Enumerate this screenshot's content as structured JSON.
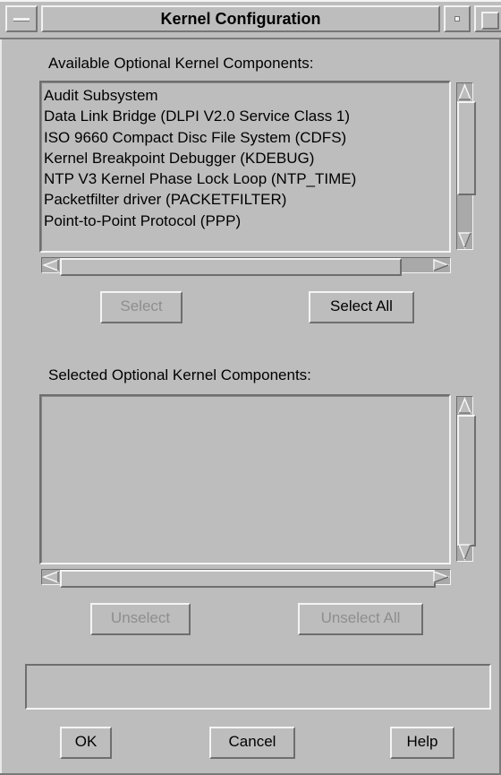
{
  "window": {
    "title": "Kernel Configuration"
  },
  "available": {
    "label": "Available Optional Kernel Components:",
    "items": [
      "Audit Subsystem",
      "Data Link Bridge (DLPI V2.0 Service Class 1)",
      "ISO 9660 Compact Disc File System (CDFS)",
      "Kernel Breakpoint Debugger (KDEBUG)",
      "NTP V3 Kernel Phase Lock Loop (NTP_TIME)",
      "Packetfilter driver (PACKETFILTER)",
      "Point-to-Point Protocol (PPP)"
    ],
    "select_label": "Select",
    "select_all_label": "Select All"
  },
  "selected": {
    "label": "Selected Optional Kernel Components:",
    "items": [],
    "unselect_label": "Unselect",
    "unselect_all_label": "Unselect All"
  },
  "message": "",
  "actions": {
    "ok_label": "OK",
    "cancel_label": "Cancel",
    "help_label": "Help"
  },
  "colors": {
    "background": "#bdbdbd",
    "shadow": "#6e6e6e",
    "highlight": "#f4f4f4",
    "disabled_text": "#8e8e8e"
  }
}
